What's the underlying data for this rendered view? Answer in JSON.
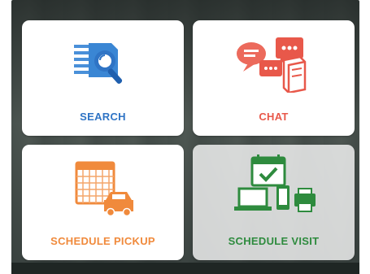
{
  "tiles": [
    {
      "label": "SEARCH",
      "icon": "search-icon",
      "color": "#2f74c5"
    },
    {
      "label": "CHAT",
      "icon": "chat-icon",
      "color": "#e8584a"
    },
    {
      "label": "SCHEDULE PICKUP",
      "icon": "schedule-pickup-icon",
      "color": "#f08a3c"
    },
    {
      "label": "SCHEDULE VISIT",
      "icon": "schedule-visit-icon",
      "color": "#2e8b3e"
    }
  ]
}
